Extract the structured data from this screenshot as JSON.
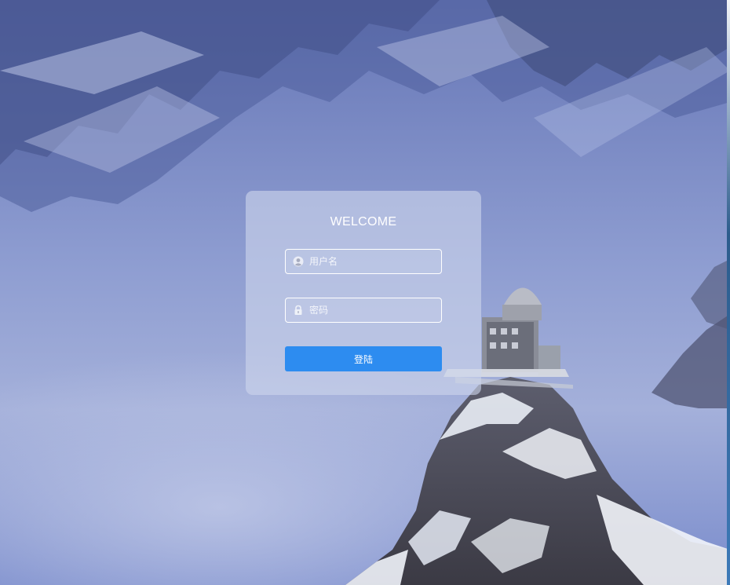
{
  "login": {
    "title": "WELCOME",
    "username": {
      "icon": "user-icon",
      "placeholder": "用户名",
      "value": ""
    },
    "password": {
      "icon": "lock-icon",
      "placeholder": "密码",
      "value": ""
    },
    "submit_label": "登陆"
  },
  "colors": {
    "button": "#2d8cf0",
    "card_overlay": "rgba(205,213,235,0.62)",
    "field_border": "#ffffff"
  }
}
